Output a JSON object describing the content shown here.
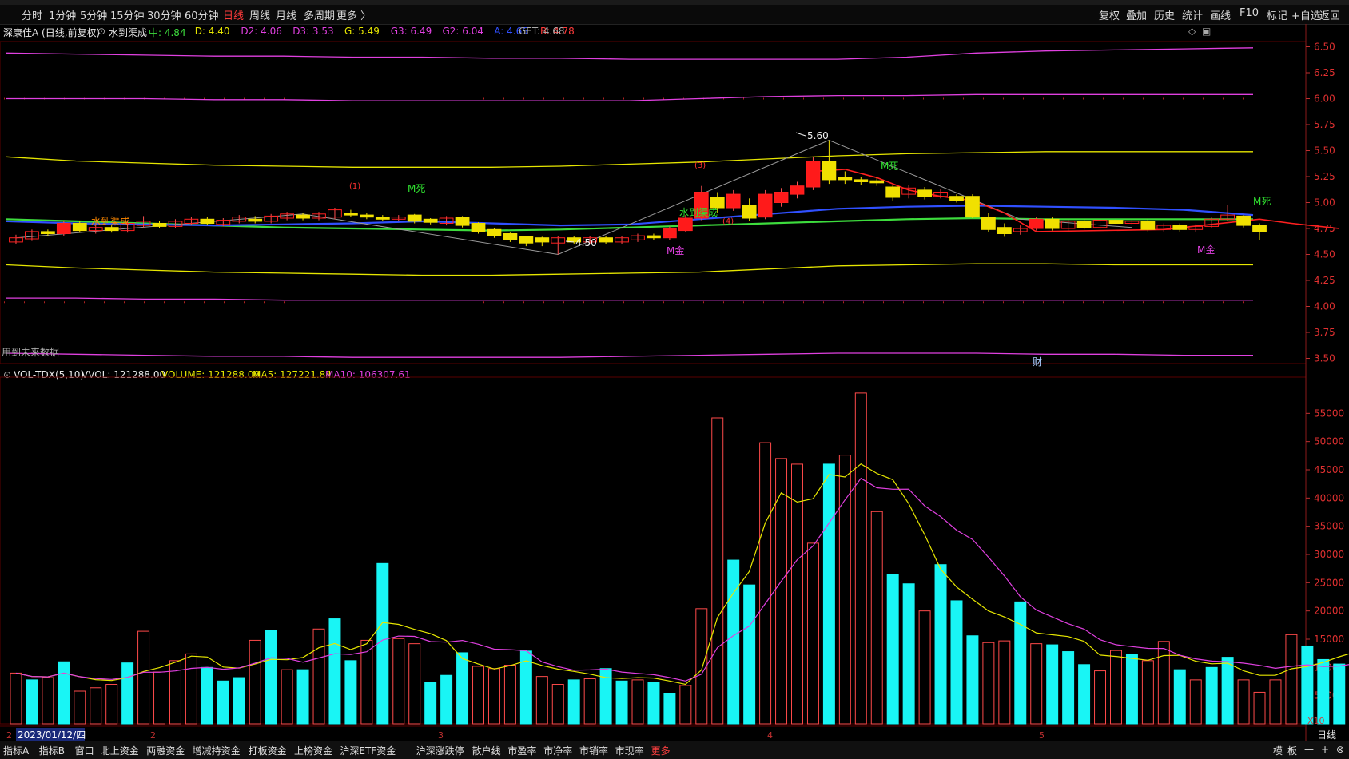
{
  "toolbar": {
    "periods": [
      "分时",
      "1分钟",
      "5分钟",
      "15分钟",
      "30分钟",
      "60分钟",
      "日线",
      "周线",
      "月线",
      "多周期",
      "更多 〉"
    ],
    "active_period": "日线",
    "right_buttons": [
      "复权",
      "叠加",
      "历史",
      "统计",
      "画线",
      "F10",
      "标记",
      "+自选",
      "返回"
    ]
  },
  "price_header": {
    "stock": "深康佳A (日线,前复权)",
    "indicator": "水到渠成",
    "items": [
      {
        "text": "中: 4.84",
        "color": "#3ddc3d"
      },
      {
        "text": "D: 4.40",
        "color": "#e6e600"
      },
      {
        "text": "D2: 4.06",
        "color": "#e040e0"
      },
      {
        "text": "D3: 3.53",
        "color": "#e040e0"
      },
      {
        "text": "G: 5.49",
        "color": "#e6e600"
      },
      {
        "text": "G3: 6.49",
        "color": "#e040e0"
      },
      {
        "text": "G2: 6.04",
        "color": "#e040e0"
      },
      {
        "text": "A: 4.65",
        "color": "#3050ff"
      },
      {
        "text": "B: 4.78",
        "color": "#ff3b3b"
      }
    ],
    "get": "GET: 4.68",
    "future_note": "用到未来数据"
  },
  "vol_header": {
    "name": "VOL-TDX(5,10)",
    "vvol": "VVOL: 121288.00",
    "volume": "VOLUME: 121288.00",
    "ma5": "MA5: 127221.84",
    "ma10": "MA10: 106307.61",
    "scale": "X10"
  },
  "annotations": {
    "high": "5.60",
    "low": "4.50",
    "m_dead_1": "M死",
    "m_dead_2": "M死",
    "m_dead_3": "M死",
    "m_gold_1": "M金",
    "m_gold_2": "M金",
    "sdqc_1": "水到渠成",
    "sdqc_2": "水到渠成",
    "mark_1": "(1)",
    "mark_2": "(3)",
    "mark_3": "(4)",
    "cai": "财"
  },
  "date_axis": {
    "first_label": "2023/01/12/四",
    "months": [
      "2",
      "3",
      "4",
      "5"
    ],
    "period_label": "日线"
  },
  "bottom_tabs": [
    "指标A",
    "指标B",
    "窗口",
    "北上资金",
    "两融资金",
    "增减持资金",
    "打板资金",
    "上榜资金",
    "沪深ETF资金",
    "沪深涨跌停",
    "散户线",
    "市盈率",
    "市净率",
    "市销率",
    "市现率",
    "更多"
  ],
  "bottom_right": [
    "模",
    "板",
    "—",
    "+",
    "⊗"
  ],
  "chart_data": [
    {
      "type": "candlestick",
      "title": "深康佳A (日线,前复权)",
      "y_ticks": [
        6.5,
        6.25,
        6.0,
        5.75,
        5.5,
        5.25,
        5.0,
        4.75,
        4.5,
        4.25,
        4.0,
        3.75,
        3.5
      ],
      "ylim": [
        3.45,
        6.55
      ],
      "candles": [
        {
          "o": 4.62,
          "c": 4.66,
          "h": 4.69,
          "l": 4.6
        },
        {
          "o": 4.65,
          "c": 4.72,
          "h": 4.74,
          "l": 4.63
        },
        {
          "o": 4.72,
          "c": 4.7,
          "h": 4.74,
          "l": 4.68
        },
        {
          "o": 4.7,
          "c": 4.8,
          "h": 4.82,
          "l": 4.68
        },
        {
          "o": 4.8,
          "c": 4.73,
          "h": 4.82,
          "l": 4.71
        },
        {
          "o": 4.73,
          "c": 4.76,
          "h": 4.78,
          "l": 4.7
        },
        {
          "o": 4.76,
          "c": 4.73,
          "h": 4.78,
          "l": 4.71
        },
        {
          "o": 4.73,
          "c": 4.8,
          "h": 4.82,
          "l": 4.71
        },
        {
          "o": 4.78,
          "c": 4.82,
          "h": 4.87,
          "l": 4.76
        },
        {
          "o": 4.8,
          "c": 4.77,
          "h": 4.82,
          "l": 4.75
        },
        {
          "o": 4.77,
          "c": 4.82,
          "h": 4.84,
          "l": 4.75
        },
        {
          "o": 4.8,
          "c": 4.84,
          "h": 4.86,
          "l": 4.78
        },
        {
          "o": 4.84,
          "c": 4.8,
          "h": 4.86,
          "l": 4.78
        },
        {
          "o": 4.79,
          "c": 4.83,
          "h": 4.85,
          "l": 4.77
        },
        {
          "o": 4.82,
          "c": 4.86,
          "h": 4.88,
          "l": 4.8
        },
        {
          "o": 4.84,
          "c": 4.82,
          "h": 4.87,
          "l": 4.8
        },
        {
          "o": 4.82,
          "c": 4.87,
          "h": 4.89,
          "l": 4.8
        },
        {
          "o": 4.85,
          "c": 4.89,
          "h": 4.91,
          "l": 4.83
        },
        {
          "o": 4.88,
          "c": 4.85,
          "h": 4.9,
          "l": 4.83
        },
        {
          "o": 4.85,
          "c": 4.89,
          "h": 4.91,
          "l": 4.83
        },
        {
          "o": 4.86,
          "c": 4.93,
          "h": 4.95,
          "l": 4.84
        },
        {
          "o": 4.9,
          "c": 4.88,
          "h": 4.93,
          "l": 4.86
        },
        {
          "o": 4.88,
          "c": 4.86,
          "h": 4.9,
          "l": 4.84
        },
        {
          "o": 4.86,
          "c": 4.84,
          "h": 4.88,
          "l": 4.82
        },
        {
          "o": 4.84,
          "c": 4.86,
          "h": 4.88,
          "l": 4.82
        },
        {
          "o": 4.88,
          "c": 4.82,
          "h": 4.89,
          "l": 4.8
        },
        {
          "o": 4.84,
          "c": 4.81,
          "h": 4.85,
          "l": 4.79
        },
        {
          "o": 4.8,
          "c": 4.85,
          "h": 4.87,
          "l": 4.78
        },
        {
          "o": 4.86,
          "c": 4.78,
          "h": 4.87,
          "l": 4.76
        },
        {
          "o": 4.8,
          "c": 4.72,
          "h": 4.81,
          "l": 4.7
        },
        {
          "o": 4.74,
          "c": 4.68,
          "h": 4.75,
          "l": 4.66
        },
        {
          "o": 4.7,
          "c": 4.64,
          "h": 4.71,
          "l": 4.62
        },
        {
          "o": 4.67,
          "c": 4.61,
          "h": 4.68,
          "l": 4.58
        },
        {
          "o": 4.66,
          "c": 4.62,
          "h": 4.67,
          "l": 4.58
        },
        {
          "o": 4.61,
          "c": 4.66,
          "h": 4.68,
          "l": 4.5
        },
        {
          "o": 4.66,
          "c": 4.62,
          "h": 4.68,
          "l": 4.6
        },
        {
          "o": 4.62,
          "c": 4.66,
          "h": 4.68,
          "l": 4.6
        },
        {
          "o": 4.66,
          "c": 4.62,
          "h": 4.68,
          "l": 4.6
        },
        {
          "o": 4.62,
          "c": 4.66,
          "h": 4.68,
          "l": 4.6
        },
        {
          "o": 4.64,
          "c": 4.68,
          "h": 4.7,
          "l": 4.62
        },
        {
          "o": 4.68,
          "c": 4.66,
          "h": 4.7,
          "l": 4.64
        },
        {
          "o": 4.66,
          "c": 4.75,
          "h": 4.77,
          "l": 4.64
        },
        {
          "o": 4.73,
          "c": 4.85,
          "h": 4.88,
          "l": 4.72
        },
        {
          "o": 4.85,
          "c": 5.1,
          "h": 5.16,
          "l": 4.83
        },
        {
          "o": 5.05,
          "c": 4.95,
          "h": 5.1,
          "l": 4.9
        },
        {
          "o": 4.95,
          "c": 5.08,
          "h": 5.12,
          "l": 4.92
        },
        {
          "o": 4.97,
          "c": 4.85,
          "h": 5.04,
          "l": 4.82
        },
        {
          "o": 4.86,
          "c": 5.08,
          "h": 5.12,
          "l": 4.84
        },
        {
          "o": 5.0,
          "c": 5.1,
          "h": 5.14,
          "l": 4.96
        },
        {
          "o": 5.08,
          "c": 5.16,
          "h": 5.2,
          "l": 5.04
        },
        {
          "o": 5.15,
          "c": 5.4,
          "h": 5.44,
          "l": 5.12
        },
        {
          "o": 5.4,
          "c": 5.22,
          "h": 5.6,
          "l": 5.18
        },
        {
          "o": 5.24,
          "c": 5.22,
          "h": 5.3,
          "l": 5.18
        },
        {
          "o": 5.22,
          "c": 5.2,
          "h": 5.25,
          "l": 5.17
        },
        {
          "o": 5.21,
          "c": 5.19,
          "h": 5.24,
          "l": 5.16
        },
        {
          "o": 5.15,
          "c": 5.05,
          "h": 5.17,
          "l": 5.02
        },
        {
          "o": 5.08,
          "c": 5.14,
          "h": 5.17,
          "l": 5.04
        },
        {
          "o": 5.12,
          "c": 5.06,
          "h": 5.15,
          "l": 5.03
        },
        {
          "o": 5.06,
          "c": 5.1,
          "h": 5.13,
          "l": 5.04
        },
        {
          "o": 5.06,
          "c": 5.02,
          "h": 5.08,
          "l": 5.0
        },
        {
          "o": 5.06,
          "c": 4.86,
          "h": 5.08,
          "l": 4.85
        },
        {
          "o": 4.86,
          "c": 4.74,
          "h": 4.9,
          "l": 4.72
        },
        {
          "o": 4.76,
          "c": 4.7,
          "h": 4.8,
          "l": 4.67
        },
        {
          "o": 4.72,
          "c": 4.75,
          "h": 4.78,
          "l": 4.69
        },
        {
          "o": 4.75,
          "c": 4.84,
          "h": 4.86,
          "l": 4.73
        },
        {
          "o": 4.84,
          "c": 4.75,
          "h": 4.86,
          "l": 4.73
        },
        {
          "o": 4.75,
          "c": 4.82,
          "h": 4.84,
          "l": 4.73
        },
        {
          "o": 4.82,
          "c": 4.76,
          "h": 4.84,
          "l": 4.74
        },
        {
          "o": 4.76,
          "c": 4.83,
          "h": 4.85,
          "l": 4.74
        },
        {
          "o": 4.83,
          "c": 4.8,
          "h": 4.85,
          "l": 4.78
        },
        {
          "o": 4.8,
          "c": 4.82,
          "h": 4.84,
          "l": 4.78
        },
        {
          "o": 4.82,
          "c": 4.74,
          "h": 4.84,
          "l": 4.72
        },
        {
          "o": 4.74,
          "c": 4.78,
          "h": 4.8,
          "l": 4.72
        },
        {
          "o": 4.78,
          "c": 4.74,
          "h": 4.8,
          "l": 4.72
        },
        {
          "o": 4.74,
          "c": 4.77,
          "h": 4.79,
          "l": 4.72
        },
        {
          "o": 4.77,
          "c": 4.84,
          "h": 4.86,
          "l": 4.75
        },
        {
          "o": 4.84,
          "c": 4.88,
          "h": 4.98,
          "l": 4.82
        },
        {
          "o": 4.87,
          "c": 4.78,
          "h": 4.88,
          "l": 4.76
        },
        {
          "o": 4.78,
          "c": 4.72,
          "h": 4.8,
          "l": 4.64
        }
      ],
      "overlays": [
        {
          "name": "G3",
          "color": "#e040e0",
          "values": [
            6.44,
            6.43,
            6.42,
            6.41,
            6.41,
            6.4,
            6.4,
            6.39,
            6.39,
            6.38,
            6.38,
            6.38,
            6.38,
            6.4,
            6.44,
            6.46,
            6.47,
            6.48,
            6.49
          ]
        },
        {
          "name": "G2",
          "color": "#e040e0",
          "values": [
            6.0,
            6.0,
            6.0,
            5.99,
            5.99,
            5.98,
            5.98,
            5.98,
            5.98,
            5.98,
            6.0,
            6.02,
            6.03,
            6.03,
            6.04,
            6.04,
            6.04,
            6.04,
            6.04
          ]
        },
        {
          "name": "G",
          "color": "#e6e600",
          "values": [
            5.44,
            5.4,
            5.38,
            5.36,
            5.35,
            5.34,
            5.34,
            5.34,
            5.35,
            5.37,
            5.39,
            5.42,
            5.45,
            5.47,
            5.48,
            5.49,
            5.49,
            5.49,
            5.49
          ]
        },
        {
          "name": "中",
          "color": "#3ddc3d",
          "values": [
            4.84,
            4.82,
            4.8,
            4.78,
            4.76,
            4.75,
            4.74,
            4.73,
            4.74,
            4.76,
            4.78,
            4.8,
            4.82,
            4.84,
            4.85,
            4.84,
            4.84,
            4.84,
            4.84
          ]
        },
        {
          "name": "A",
          "color": "#3050ff",
          "values": [
            4.82,
            4.8,
            4.79,
            4.78,
            4.79,
            4.8,
            4.82,
            4.8,
            4.78,
            4.79,
            4.84,
            4.89,
            4.94,
            4.96,
            4.97,
            4.96,
            4.95,
            4.93,
            4.88
          ]
        },
        {
          "name": "D",
          "color": "#e6e600",
          "values": [
            4.4,
            4.37,
            4.35,
            4.33,
            4.32,
            4.31,
            4.3,
            4.3,
            4.31,
            4.32,
            4.33,
            4.36,
            4.39,
            4.4,
            4.41,
            4.41,
            4.4,
            4.4,
            4.4
          ]
        },
        {
          "name": "D2",
          "color": "#e040e0",
          "values": [
            4.08,
            4.08,
            4.07,
            4.07,
            4.06,
            4.06,
            4.06,
            4.06,
            4.06,
            4.06,
            4.06,
            4.06,
            4.06,
            4.06,
            4.06,
            4.06,
            4.06,
            4.06,
            4.06
          ]
        },
        {
          "name": "D3",
          "color": "#e040e0",
          "values": [
            3.55,
            3.54,
            3.53,
            3.52,
            3.52,
            3.51,
            3.51,
            3.51,
            3.51,
            3.52,
            3.53,
            3.54,
            3.55,
            3.55,
            3.55,
            3.54,
            3.54,
            3.53,
            3.53
          ]
        }
      ]
    },
    {
      "type": "bar",
      "title": "VOL-TDX(5,10)",
      "y_ticks": [
        55000,
        50000,
        45000,
        40000,
        35000,
        30000,
        25000,
        20000,
        15000,
        10000,
        5000
      ],
      "ylim": [
        0,
        60000
      ],
      "volumes": [
        9000,
        7800,
        8200,
        11000,
        5800,
        6400,
        7000,
        10800,
        16400,
        9200,
        11200,
        12400,
        10000,
        7600,
        8200,
        14800,
        16600,
        9600,
        9600,
        16800,
        18600,
        11200,
        14800,
        28400,
        15100,
        14200,
        7400,
        8600,
        12600,
        10200,
        9800,
        10400,
        12900,
        8400,
        7000,
        7800,
        8000,
        9800,
        7600,
        7800,
        7400,
        5400,
        6800,
        20400,
        54200,
        29000,
        24600,
        49800,
        47000,
        46000,
        32000,
        46000,
        47600,
        58600,
        37600,
        26400,
        24800,
        20000,
        28200,
        21800,
        15600,
        14400,
        14700,
        21600,
        14200,
        14000,
        12800,
        10500,
        9400,
        13000,
        12300,
        11200,
        14600,
        9600,
        7800,
        10000,
        11800,
        7800,
        5600,
        7800,
        15800,
        13800,
        11400,
        10600,
        12100
      ],
      "up": [
        1,
        0,
        1,
        0,
        1,
        1,
        1,
        0,
        1,
        1,
        1,
        1,
        0,
        0,
        0,
        1,
        0,
        1,
        0,
        1,
        0,
        0,
        1,
        0,
        1,
        1,
        0,
        0,
        0,
        1,
        1,
        1,
        0,
        1,
        1,
        0,
        1,
        0,
        0,
        1,
        0,
        0,
        1,
        1,
        1,
        0,
        0,
        1,
        1,
        1,
        1,
        0,
        1,
        1,
        1,
        0,
        0,
        1,
        0,
        0,
        0,
        1,
        1,
        0,
        1,
        0,
        0,
        0,
        1,
        1,
        0,
        1,
        1,
        0,
        1,
        0,
        0,
        1,
        1,
        1,
        1,
        0,
        0,
        0,
        0
      ],
      "ma5_color": "#e6e600",
      "ma10_color": "#e040e0"
    }
  ]
}
